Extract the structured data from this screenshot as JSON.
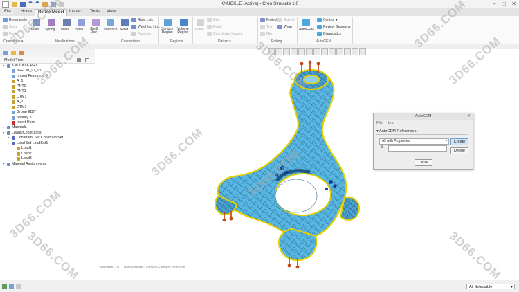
{
  "window": {
    "title": "KNUCKLE (Active) - Creo Simulate 1.0"
  },
  "tabs": [
    "File",
    "Home",
    "Refine Model",
    "Inspect",
    "Tools",
    "View"
  ],
  "active_tab": "Refine Model",
  "ribbon": {
    "regenerate": "Regenerate",
    "copy": "Copy",
    "paste": "Paste",
    "beam": "Beam",
    "spring": "Spring",
    "mass": "Mass",
    "shell": "Shell",
    "shell_pair": "Shell\nPair",
    "interface": "Interface",
    "weld": "Weld",
    "rigid_link": "Rigid Link",
    "weighted_link": "Weighted Link",
    "fastener": "Fastener",
    "surface_region": "Surface\nRegion",
    "volume_region": "Volume\nRegion",
    "plane": "Plane",
    "axis": "Axis",
    "point": "Point",
    "coord_system": "Coordinate System",
    "project": "Project",
    "trim": "Trim",
    "wrap": "Wrap",
    "extend": "Extend",
    "autogem": "AutoGEM",
    "control": "Control",
    "review_geometry": "Review Geometry",
    "diagnostics": "Diagnostics",
    "groups": {
      "operations": "Operations",
      "idealizations": "Idealizations",
      "connections": "Connections",
      "regions": "Regions",
      "datum": "Datum",
      "editing": "Editing",
      "autogem": "AutoGEM"
    }
  },
  "tree": {
    "header": "Model Tree",
    "items": [
      {
        "label": "KNUCKLE.PRT",
        "level": 0,
        "color": "#6b8cc7"
      },
      {
        "label": "*GEOM_ID_10",
        "level": 1,
        "color": "#7aa0d8"
      },
      {
        "label": "Import Feature id 8",
        "level": 1,
        "color": "#7aa0d8"
      },
      {
        "label": "A_1",
        "level": 1,
        "color": "#c8a030"
      },
      {
        "label": "PNT0",
        "level": 1,
        "color": "#c8a030"
      },
      {
        "label": "PNT1",
        "level": 1,
        "color": "#c8a030"
      },
      {
        "label": "DTM1",
        "level": 1,
        "color": "#c8a030"
      },
      {
        "label": "A_2",
        "level": 1,
        "color": "#c8a030"
      },
      {
        "label": "DTM2",
        "level": 1,
        "color": "#c8a030"
      },
      {
        "label": "Group EDIT",
        "level": 1,
        "color": "#7aa0d8"
      },
      {
        "label": "Solidify 5",
        "level": 1,
        "color": "#7aa0d8"
      },
      {
        "label": "Insert Here",
        "level": 1,
        "color": "#c83030"
      },
      {
        "label": "Materials",
        "level": 0,
        "color": "#6b8cc7"
      },
      {
        "label": "Loads/Constraints",
        "level": 0,
        "color": "#6b8cc7"
      },
      {
        "label": "Constraint Set ConstraintSet1",
        "level": 1,
        "color": "#5b6fc0"
      },
      {
        "label": "Load Set LoadSet1",
        "level": 1,
        "color": "#5b6fc0"
      },
      {
        "label": "Load1",
        "level": 2,
        "color": "#c8a030"
      },
      {
        "label": "Load2",
        "level": 2,
        "color": "#c8a030"
      },
      {
        "label": "Load3",
        "level": 2,
        "color": "#c8a030"
      },
      {
        "label": "Material Assignments",
        "level": 0,
        "color": "#6b8cc7"
      }
    ]
  },
  "dialog": {
    "title": "AutoGEM",
    "menu": [
      "File",
      "Info"
    ],
    "section": "AutoGEM References",
    "select_value": "All with Properties",
    "label": "S",
    "create": "Create",
    "delete": "Delete",
    "close": "Close"
  },
  "viewport": {
    "message": "Structure  ·  3D  ·  Native Mode  ·  Default Element Interface"
  },
  "status": {
    "filter": "All Selectable"
  },
  "watermarks": [
    "3D66.COM",
    "3D66.COM",
    "3D66.COM",
    "3D66.COM",
    "3D66.COM",
    "3D66.COM",
    "3D66.COM",
    "3D66.COM",
    "3D66.COM",
    "3D66.COM"
  ],
  "colors": {
    "mesh": "#58b6e3",
    "mesh_edge": "#1a4a6a",
    "mesh_outline": "#e2d000"
  }
}
